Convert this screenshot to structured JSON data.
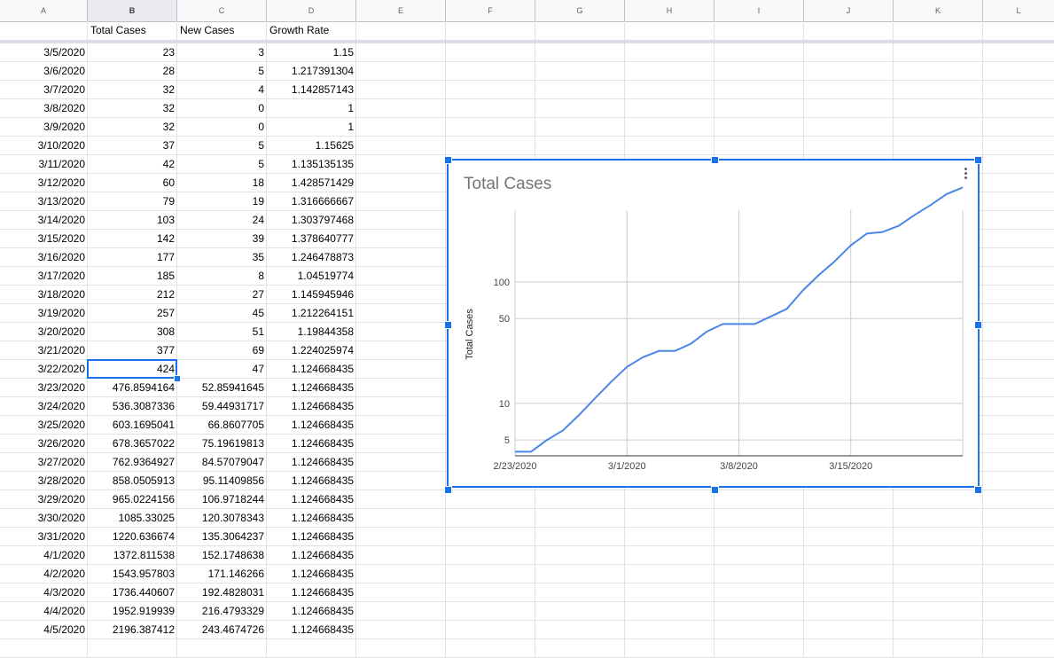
{
  "columns": [
    "A",
    "B",
    "C",
    "D",
    "E",
    "F",
    "G",
    "H",
    "I",
    "J",
    "K",
    "L"
  ],
  "headers": {
    "b": "Total Cases",
    "c": "New Cases",
    "d": "Growth Rate"
  },
  "rows": [
    [
      "3/5/2020",
      "23",
      "3",
      "1.15"
    ],
    [
      "3/6/2020",
      "28",
      "5",
      "1.217391304"
    ],
    [
      "3/7/2020",
      "32",
      "4",
      "1.142857143"
    ],
    [
      "3/8/2020",
      "32",
      "0",
      "1"
    ],
    [
      "3/9/2020",
      "32",
      "0",
      "1"
    ],
    [
      "3/10/2020",
      "37",
      "5",
      "1.15625"
    ],
    [
      "3/11/2020",
      "42",
      "5",
      "1.135135135"
    ],
    [
      "3/12/2020",
      "60",
      "18",
      "1.428571429"
    ],
    [
      "3/13/2020",
      "79",
      "19",
      "1.316666667"
    ],
    [
      "3/14/2020",
      "103",
      "24",
      "1.303797468"
    ],
    [
      "3/15/2020",
      "142",
      "39",
      "1.378640777"
    ],
    [
      "3/16/2020",
      "177",
      "35",
      "1.246478873"
    ],
    [
      "3/17/2020",
      "185",
      "8",
      "1.04519774"
    ],
    [
      "3/18/2020",
      "212",
      "27",
      "1.145945946"
    ],
    [
      "3/19/2020",
      "257",
      "45",
      "1.212264151"
    ],
    [
      "3/20/2020",
      "308",
      "51",
      "1.19844358"
    ],
    [
      "3/21/2020",
      "377",
      "69",
      "1.224025974"
    ],
    [
      "3/22/2020",
      "424",
      "47",
      "1.124668435"
    ],
    [
      "3/23/2020",
      "476.8594164",
      "52.85941645",
      "1.124668435"
    ],
    [
      "3/24/2020",
      "536.3087336",
      "59.44931717",
      "1.124668435"
    ],
    [
      "3/25/2020",
      "603.1695041",
      "66.8607705",
      "1.124668435"
    ],
    [
      "3/26/2020",
      "678.3657022",
      "75.19619813",
      "1.124668435"
    ],
    [
      "3/27/2020",
      "762.9364927",
      "84.57079047",
      "1.124668435"
    ],
    [
      "3/28/2020",
      "858.0505913",
      "95.11409856",
      "1.124668435"
    ],
    [
      "3/29/2020",
      "965.0224156",
      "106.9718244",
      "1.124668435"
    ],
    [
      "3/30/2020",
      "1085.33025",
      "120.3078343",
      "1.124668435"
    ],
    [
      "3/31/2020",
      "1220.636674",
      "135.3064237",
      "1.124668435"
    ],
    [
      "4/1/2020",
      "1372.811538",
      "152.1748638",
      "1.124668435"
    ],
    [
      "4/2/2020",
      "1543.957803",
      "171.146266",
      "1.124668435"
    ],
    [
      "4/3/2020",
      "1736.440607",
      "192.4828031",
      "1.124668435"
    ],
    [
      "4/4/2020",
      "1952.919939",
      "216.4793329",
      "1.124668435"
    ],
    [
      "4/5/2020",
      "2196.387412",
      "243.4674726",
      "1.124668435"
    ]
  ],
  "selected_cell": "B18",
  "chart_data": {
    "type": "line",
    "title": "Total Cases",
    "xlabel": "",
    "ylabel": "Total Cases",
    "y_scale": "log",
    "ylim": [
      3.7,
      390
    ],
    "xlim": [
      "2/23/2020",
      "3/22/2020"
    ],
    "y_ticks": [
      5,
      10,
      50,
      100
    ],
    "x_ticks": [
      "2/23/2020",
      "3/1/2020",
      "3/8/2020",
      "3/15/2020"
    ],
    "grid": true,
    "legend": "none",
    "color": "#4a86e8",
    "series": [
      {
        "x": [
          "2/23/2020",
          "2/24/2020",
          "2/25/2020",
          "2/26/2020",
          "2/27/2020",
          "2/28/2020",
          "2/29/2020",
          "3/1/2020",
          "3/2/2020",
          "3/3/2020",
          "3/4/2020",
          "3/5/2020",
          "3/6/2020",
          "3/7/2020",
          "3/8/2020",
          "3/9/2020",
          "3/10/2020",
          "3/11/2020",
          "3/12/2020",
          "3/13/2020",
          "3/14/2020",
          "3/15/2020",
          "3/16/2020",
          "3/17/2020",
          "3/18/2020",
          "3/19/2020",
          "3/20/2020",
          "3/21/2020",
          "3/22/2020"
        ],
        "values": [
          4,
          4,
          5,
          6,
          8,
          11,
          15,
          20,
          24,
          27,
          27,
          31,
          39,
          45,
          45,
          45,
          52,
          60,
          85,
          114,
          148,
          200,
          250,
          258,
          290,
          357,
          430,
          530,
          600
        ]
      }
    ]
  }
}
